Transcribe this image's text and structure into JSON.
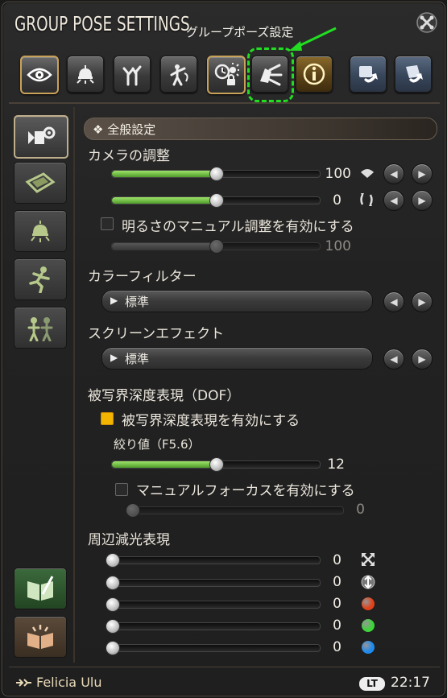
{
  "window": {
    "title": "GROUP POSE SETTINGS",
    "subtitle": "グループポーズ設定"
  },
  "toolbar": {
    "buttons": [
      {
        "name": "eye-icon"
      },
      {
        "name": "lamp-icon"
      },
      {
        "name": "tree-icon"
      },
      {
        "name": "pose-icon"
      },
      {
        "name": "time-icon"
      },
      {
        "name": "camera-filter-icon"
      },
      {
        "name": "info-icon"
      },
      {
        "name": "rotate-left-icon"
      },
      {
        "name": "rotate-right-icon"
      }
    ]
  },
  "sidebar": {
    "items": [
      {
        "name": "camera-settings-icon"
      },
      {
        "name": "frame-icon"
      },
      {
        "name": "light-icon"
      },
      {
        "name": "running-icon"
      },
      {
        "name": "group-icon"
      }
    ]
  },
  "section": {
    "header": "❖ 全般設定"
  },
  "camera": {
    "label": "カメラの調整",
    "slider1_value": "100",
    "slider1_level": 0.5,
    "slider2_value": "0",
    "slider2_level": 0.5,
    "brightness_label": "明るさのマニュアル調整を有効にする",
    "brightness_value": "100",
    "brightness_level": 0.5
  },
  "color_filter": {
    "label": "カラーフィルター",
    "selected": "標準"
  },
  "screen_effect": {
    "label": "スクリーンエフェクト",
    "selected": "標準"
  },
  "dof": {
    "label": "被写界深度表現（DOF）",
    "enable_label": "被写界深度表現を有効にする",
    "aperture_label": "絞り値（F5.6）",
    "aperture_value": "12",
    "aperture_level": 0.5,
    "manual_focus_label": "マニュアルフォーカスを有効にする",
    "manual_focus_value": "0",
    "manual_focus_level": 0.0
  },
  "vignette": {
    "label": "周辺減光表現",
    "rows": [
      {
        "value": "0",
        "icon": "resize-icon",
        "color": ""
      },
      {
        "value": "0",
        "icon": "vertical-resize-icon",
        "color": ""
      },
      {
        "value": "0",
        "icon": "red-dot",
        "color": "#e0421a"
      },
      {
        "value": "0",
        "icon": "green-dot",
        "color": "#3ed43a"
      },
      {
        "value": "0",
        "icon": "blue-dot",
        "color": "#1e8aee"
      }
    ]
  },
  "footer": {
    "player": "Felicia Ulu",
    "lt_badge": "LT",
    "time": "22:17"
  }
}
